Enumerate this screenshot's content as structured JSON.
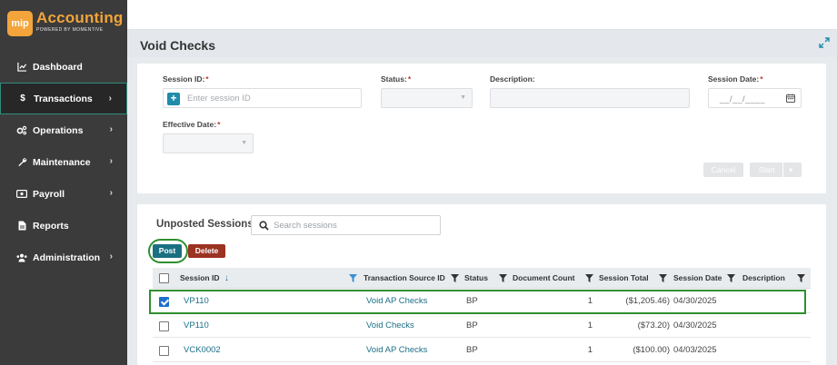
{
  "app": {
    "logo_badge": "mip",
    "logo_title": "Accounting",
    "logo_subtitle": "POWERED BY MOMENTIVE"
  },
  "sidebar": {
    "items": [
      {
        "label": "Dashboard",
        "icon": "chart-line-icon",
        "has_chevron": false
      },
      {
        "label": "Transactions",
        "icon": "dollar-icon",
        "has_chevron": true,
        "active": true
      },
      {
        "label": "Operations",
        "icon": "cogs-icon",
        "has_chevron": true
      },
      {
        "label": "Maintenance",
        "icon": "wrench-icon",
        "has_chevron": true
      },
      {
        "label": "Payroll",
        "icon": "money-bill-icon",
        "has_chevron": true
      },
      {
        "label": "Reports",
        "icon": "file-icon",
        "has_chevron": false
      },
      {
        "label": "Administration",
        "icon": "users-icon",
        "has_chevron": true
      }
    ],
    "chevron": "›"
  },
  "page": {
    "title": "Void Checks"
  },
  "form": {
    "session_id_label": "Session ID:",
    "session_id_placeholder": "Enter session ID",
    "status_label": "Status:",
    "description_label": "Description:",
    "session_date_label": "Session Date:",
    "session_date_placeholder": "__/__/____",
    "effective_date_label": "Effective Date:",
    "required_mark": "*",
    "cancel_label": "Cancel",
    "start_label": "Start",
    "start_caret": "▾"
  },
  "sessions": {
    "title": "Unposted Sessions",
    "separator": ":",
    "search_placeholder": "Search sessions",
    "post_label": "Post",
    "delete_label": "Delete",
    "columns": [
      "Session ID",
      "Transaction Source ID",
      "Status",
      "Document Count",
      "Session Total",
      "Session Date",
      "Description"
    ],
    "sort_indicator": "↓",
    "rows": [
      {
        "session_id": "VP110",
        "source": "Void AP Checks",
        "status": "BP",
        "count": "1",
        "total": "($1,205.46)",
        "date": "04/30/2025",
        "description": "",
        "checked": true
      },
      {
        "session_id": "VP110",
        "source": "Void Checks",
        "status": "BP",
        "count": "1",
        "total": "($73.20)",
        "date": "04/30/2025",
        "description": "",
        "checked": false
      },
      {
        "session_id": "VCK0002",
        "source": "Void AP Checks",
        "status": "BP",
        "count": "1",
        "total": "($100.00)",
        "date": "04/03/2025",
        "description": "",
        "checked": false
      }
    ]
  },
  "colors": {
    "accent": "#1a7081",
    "delete": "#9b3222",
    "highlight": "#2f8f2f",
    "sidebar_bg": "#3b3b3b",
    "brand": "#f3a43a"
  }
}
